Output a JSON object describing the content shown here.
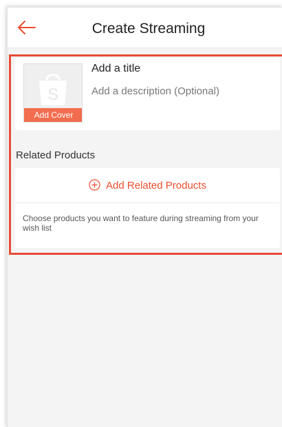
{
  "header": {
    "title": "Create Streaming"
  },
  "stream": {
    "title_placeholder": "Add a title",
    "description_placeholder": "Add a description (Optional)",
    "cover_label": "Add Cover"
  },
  "products": {
    "section_label": "Related Products",
    "add_label": "Add Related Products",
    "hint": "Choose products you want to feature during streaming from your wish list"
  },
  "colors": {
    "accent": "#ee4d2d",
    "highlight": "#e84b36",
    "cover_badge": "#f26d4f"
  },
  "icons": {
    "back": "arrow-left-icon",
    "cover": "shopping-bag-icon",
    "add": "plus-circle-icon"
  }
}
